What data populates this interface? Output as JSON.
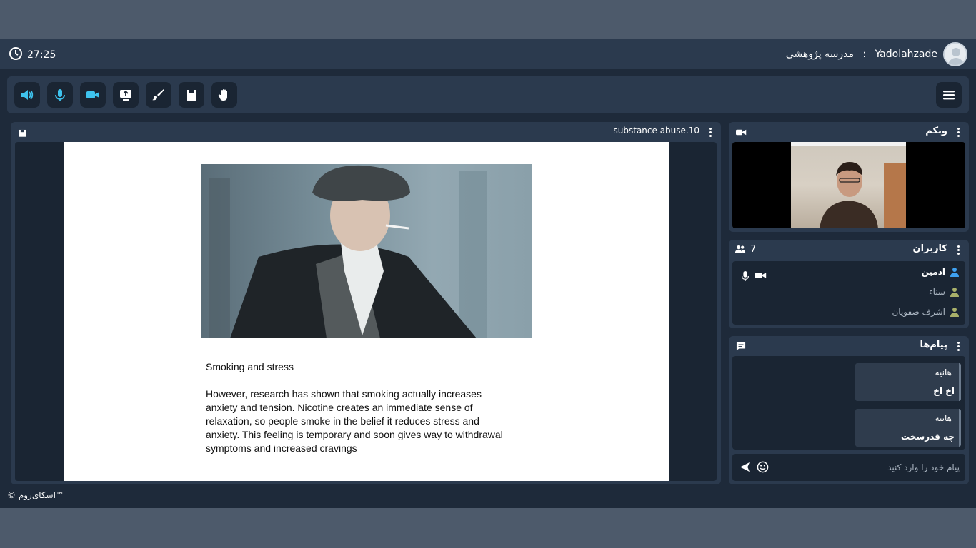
{
  "header": {
    "timer": "27:25",
    "user_name": "Yadolahzade",
    "separator": " : ",
    "room_name": "مدرسه پژوهشی"
  },
  "toolbar": {
    "buttons": [
      {
        "icon": "speaker-icon"
      },
      {
        "icon": "microphone-icon"
      },
      {
        "icon": "video-camera-icon"
      },
      {
        "icon": "screen-share-icon"
      },
      {
        "icon": "brush-icon"
      },
      {
        "icon": "file-icon"
      },
      {
        "icon": "raise-hand-icon"
      }
    ],
    "accent": "#3ec3ee"
  },
  "presentation": {
    "file_name": "substance abuse.10",
    "slide_heading": "Smoking and stress",
    "slide_body": "However, research has shown that smoking actually increases anxiety and tension. Nicotine creates an immediate sense of relaxation, so people smoke in the belief it reduces stress and anxiety. This feeling is temporary and soon gives way to withdrawal symptoms and increased cravings"
  },
  "webcam": {
    "title": "وبکم"
  },
  "users": {
    "title": "کاربران",
    "count": "7",
    "list": [
      {
        "name": "ادمین",
        "role": "admin"
      },
      {
        "name": "سناء",
        "role": "user"
      },
      {
        "name": "اشرف صفویان",
        "role": "user"
      }
    ]
  },
  "chat": {
    "title": "پیام‌ها",
    "messages": [
      {
        "author": "هانیه",
        "text": "اخ اخ"
      },
      {
        "author": "هانیه",
        "text": "چه قدرسخت"
      }
    ],
    "placeholder": "پیام خود را وارد کنید"
  },
  "footer": {
    "brand": "© اسکای‌روم™"
  }
}
